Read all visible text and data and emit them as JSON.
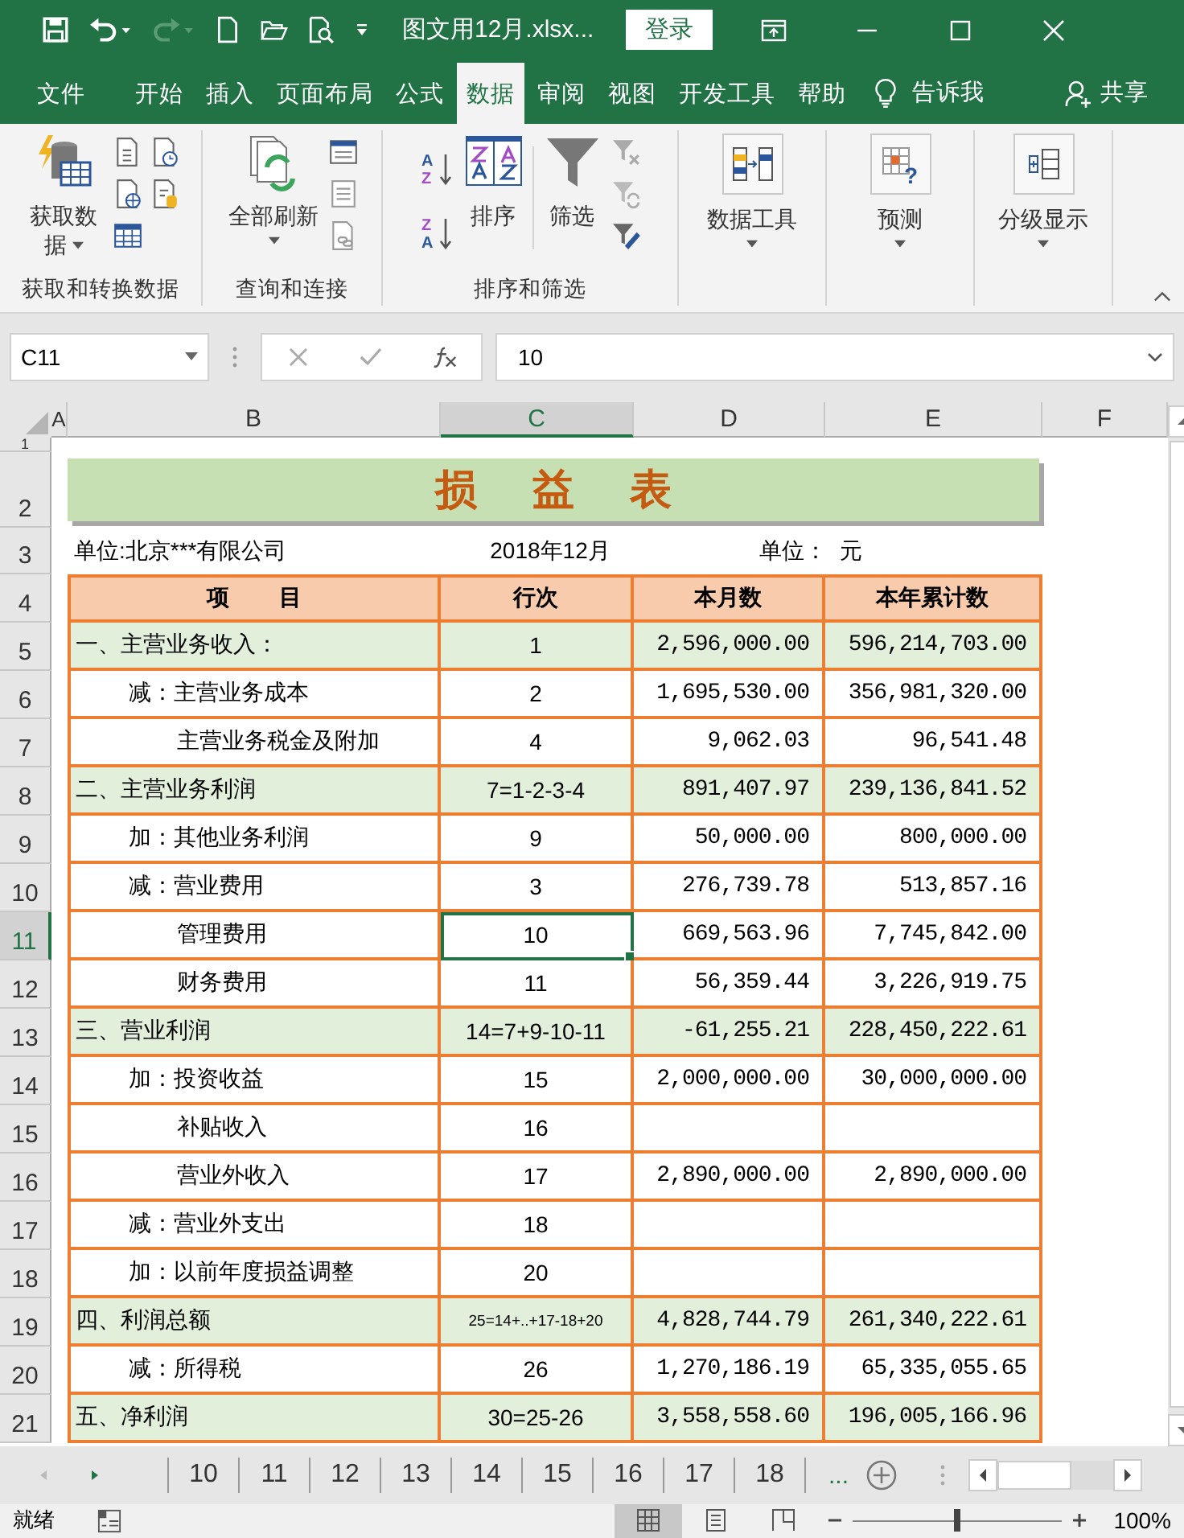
{
  "title_bar": {
    "filename": "图文用12月.xlsx...",
    "login_button": "登录"
  },
  "menu_tabs": [
    {
      "label": "文件",
      "selected": false
    },
    {
      "label": "开始",
      "selected": false
    },
    {
      "label": "插入",
      "selected": false
    },
    {
      "label": "页面布局",
      "selected": false
    },
    {
      "label": "公式",
      "selected": false
    },
    {
      "label": "数据",
      "selected": true
    },
    {
      "label": "审阅",
      "selected": false
    },
    {
      "label": "视图",
      "selected": false
    },
    {
      "label": "开发工具",
      "selected": false
    },
    {
      "label": "帮助",
      "selected": false
    }
  ],
  "tell_me": "告诉我",
  "share": "共享",
  "ribbon": {
    "get_data": {
      "button": "获取数",
      "button_line2": "据",
      "group_label": "获取和转换数据"
    },
    "queries": {
      "button": "全部刷新",
      "group_label": "查询和连接"
    },
    "sort_filter": {
      "ascending_icon": [
        "A",
        "Z"
      ],
      "descending_icon": [
        "Z",
        "A"
      ],
      "sort": "排序",
      "filter": "筛选",
      "group_label": "排序和筛选"
    },
    "data_tools": "数据工具",
    "forecast_icon_mark": "?",
    "forecast": "预测",
    "outline": "分级显示"
  },
  "formula_bar": {
    "name_box": "C11",
    "formula": "10"
  },
  "columns": [
    {
      "label": "A",
      "selected": false
    },
    {
      "label": "B",
      "selected": false
    },
    {
      "label": "C",
      "selected": true
    },
    {
      "label": "D",
      "selected": false
    },
    {
      "label": "E",
      "selected": false
    },
    {
      "label": "F",
      "selected": false
    }
  ],
  "row_numbers": [
    {
      "label": "1",
      "selected": false
    },
    {
      "label": "2",
      "selected": false
    },
    {
      "label": "3",
      "selected": false
    },
    {
      "label": "4",
      "selected": false
    },
    {
      "label": "5",
      "selected": false
    },
    {
      "label": "6",
      "selected": false
    },
    {
      "label": "7",
      "selected": false
    },
    {
      "label": "8",
      "selected": false
    },
    {
      "label": "9",
      "selected": false
    },
    {
      "label": "10",
      "selected": false
    },
    {
      "label": "11",
      "selected": true
    },
    {
      "label": "12",
      "selected": false
    },
    {
      "label": "13",
      "selected": false
    },
    {
      "label": "14",
      "selected": false
    },
    {
      "label": "15",
      "selected": false
    },
    {
      "label": "16",
      "selected": false
    },
    {
      "label": "17",
      "selected": false
    },
    {
      "label": "18",
      "selected": false
    },
    {
      "label": "19",
      "selected": false
    },
    {
      "label": "20",
      "selected": false
    },
    {
      "label": "21",
      "selected": false
    }
  ],
  "sheet": {
    "title": "损 益 表",
    "company": "单位:北京***有限公司",
    "period": "2018年12月",
    "unit": "单位：  元",
    "headers": [
      "项        目",
      "行次",
      "本月数",
      "本年累计数"
    ],
    "rows": [
      {
        "kind": "total",
        "item": "一、主营业务收入：",
        "line": "1",
        "month": "2,596,000.00",
        "year": "596,214,703.00",
        "selected": false,
        "small_line": false
      },
      {
        "kind": "item",
        "item": "减：主营业务成本",
        "line": "2",
        "month": "1,695,530.00",
        "year": "356,981,320.00",
        "selected": false,
        "small_line": false
      },
      {
        "kind": "detail",
        "item": "主营业务税金及附加",
        "line": "4",
        "month": "9,062.03",
        "year": "96,541.48",
        "selected": false,
        "small_line": false
      },
      {
        "kind": "total",
        "item": "二、主营业务利润",
        "line": "7=1-2-3-4",
        "month": "891,407.97",
        "year": "239,136,841.52",
        "selected": false,
        "small_line": false
      },
      {
        "kind": "item",
        "item": "加：其他业务利润",
        "line": "9",
        "month": "50,000.00",
        "year": "800,000.00",
        "selected": false,
        "small_line": false
      },
      {
        "kind": "item",
        "item": "减：营业费用",
        "line": "3",
        "month": "276,739.78",
        "year": "513,857.16",
        "selected": false,
        "small_line": false
      },
      {
        "kind": "detail",
        "item": "管理费用",
        "line": "10",
        "month": "669,563.96",
        "year": "7,745,842.00",
        "selected": true,
        "small_line": false
      },
      {
        "kind": "detail",
        "item": "财务费用",
        "line": "11",
        "month": "56,359.44",
        "year": "3,226,919.75",
        "selected": false,
        "small_line": false
      },
      {
        "kind": "total",
        "item": "三、营业利润",
        "line": "14=7+9-10-11",
        "month": "-61,255.21",
        "year": "228,450,222.61",
        "selected": false,
        "small_line": false
      },
      {
        "kind": "item",
        "item": "加：投资收益",
        "line": "15",
        "month": "2,000,000.00",
        "year": "30,000,000.00",
        "selected": false,
        "small_line": false
      },
      {
        "kind": "detail",
        "item": "补贴收入",
        "line": "16",
        "selected": false,
        "small_line": false
      },
      {
        "kind": "detail",
        "item": "营业外收入",
        "line": "17",
        "month": "2,890,000.00",
        "year": "2,890,000.00",
        "selected": false,
        "small_line": false
      },
      {
        "kind": "item",
        "item": "减：营业外支出",
        "line": "18",
        "selected": false,
        "small_line": false
      },
      {
        "kind": "item",
        "item": "加：以前年度损益调整",
        "line": "20",
        "selected": false,
        "small_line": false
      },
      {
        "kind": "total",
        "item": "四、利润总额",
        "line": "25=14+..+17-18+20",
        "month": "4,828,744.79",
        "year": "261,340,222.61",
        "selected": false,
        "small_line": true
      },
      {
        "kind": "item",
        "item": "减：所得税",
        "line": "26",
        "month": "1,270,186.19",
        "year": "65,335,055.65",
        "selected": false,
        "small_line": false
      },
      {
        "kind": "total",
        "item": "五、净利润",
        "line": "30=25-26",
        "month": "3,558,558.60",
        "year": "196,005,166.96",
        "selected": false,
        "small_line": false
      }
    ]
  },
  "sheet_tabs": [
    "10",
    "11",
    "12",
    "13",
    "14",
    "15",
    "16",
    "17",
    "18"
  ],
  "more_tabs": "...",
  "status_bar": {
    "status": "就绪",
    "zoom_slider": {
      "level": 0.5
    },
    "zoom": "100%"
  }
}
